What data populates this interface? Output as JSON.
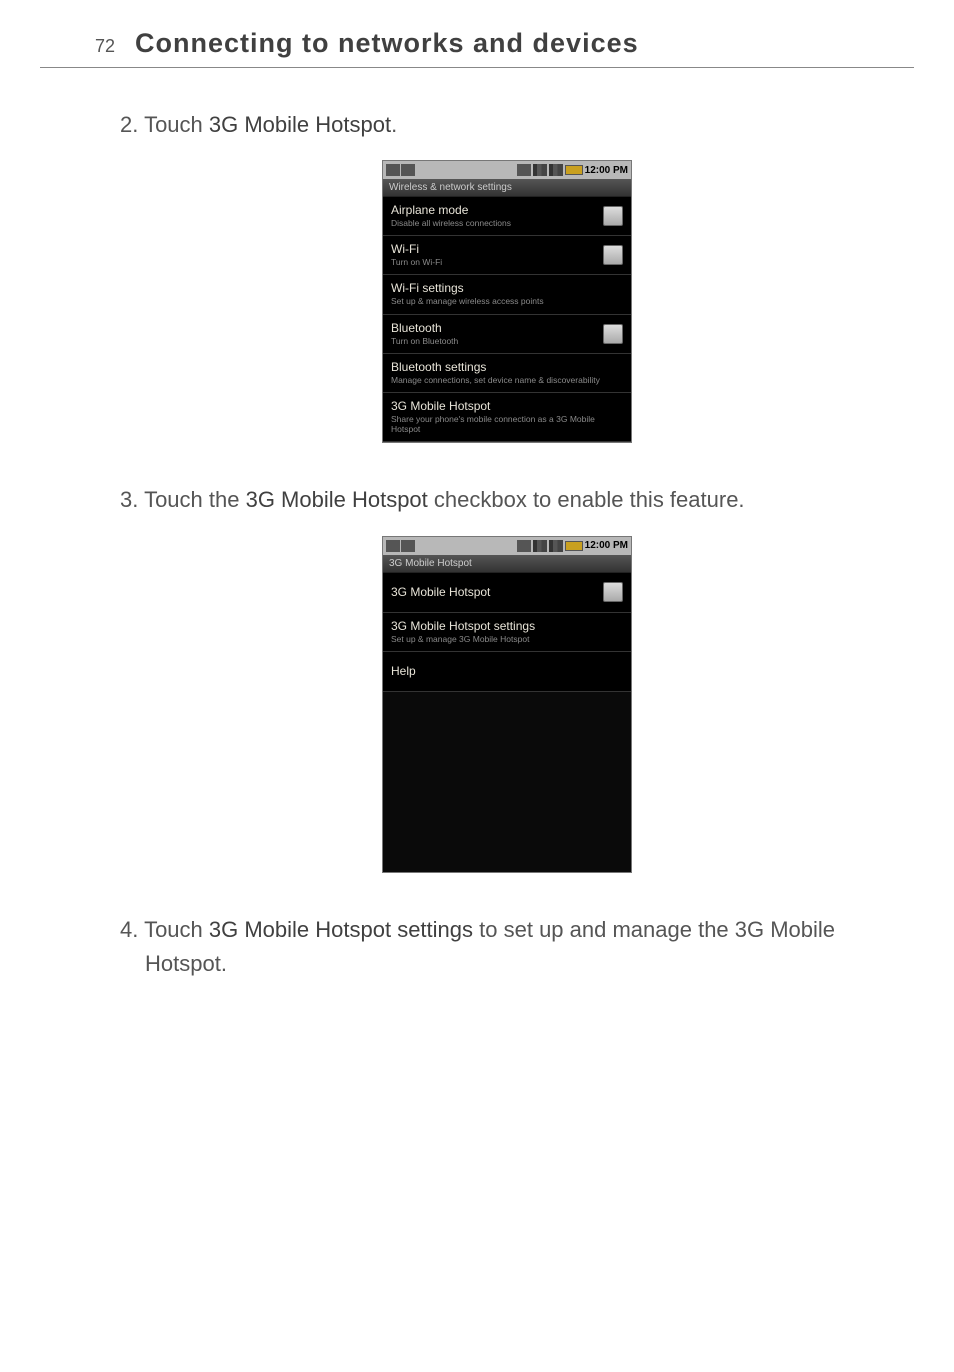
{
  "header": {
    "page_number": "72",
    "title": "Connecting to networks and devices"
  },
  "steps": {
    "s2_prefix": "2. Touch ",
    "s2_bold": "3G Mobile Hotspot",
    "s2_suffix": ".",
    "s3_prefix": "3. Touch the ",
    "s3_bold": "3G Mobile Hotspot",
    "s3_suffix": " checkbox to enable this feature.",
    "s4_prefix": "4. Touch ",
    "s4_bold": "3G Mobile Hotspot settings",
    "s4_suffix": " to set up and manage the 3G Mobile Hotspot."
  },
  "phone1": {
    "time": "12:00 PM",
    "screen_title": "Wireless & network settings",
    "items": [
      {
        "title": "Airplane mode",
        "sub": "Disable all wireless connections",
        "checkbox": true
      },
      {
        "title": "Wi-Fi",
        "sub": "Turn on Wi-Fi",
        "checkbox": true
      },
      {
        "title": "Wi-Fi settings",
        "sub": "Set up & manage wireless access points",
        "checkbox": false
      },
      {
        "title": "Bluetooth",
        "sub": "Turn on Bluetooth",
        "checkbox": true
      },
      {
        "title": "Bluetooth settings",
        "sub": "Manage connections, set device name & discoverability",
        "checkbox": false
      },
      {
        "title": "3G Mobile Hotspot",
        "sub": "Share your phone's mobile connection as a 3G Mobile Hotspot",
        "checkbox": false
      }
    ]
  },
  "phone2": {
    "time": "12:00 PM",
    "screen_title": "3G Mobile Hotspot",
    "items": [
      {
        "title": "3G Mobile Hotspot",
        "sub": "",
        "checkbox": true
      },
      {
        "title": "3G Mobile Hotspot settings",
        "sub": "Set up & manage 3G Mobile Hotspot",
        "checkbox": false
      },
      {
        "title": "Help",
        "sub": "",
        "checkbox": false
      }
    ]
  }
}
